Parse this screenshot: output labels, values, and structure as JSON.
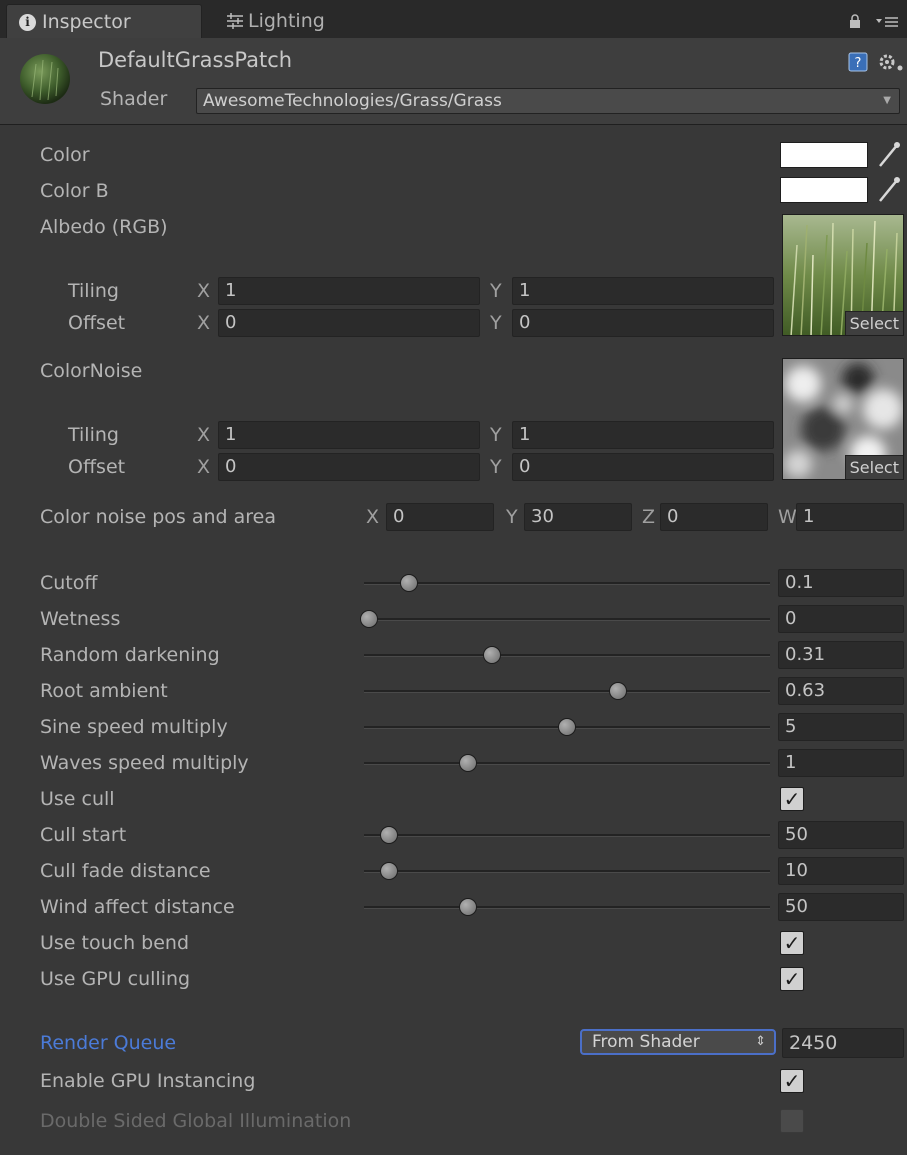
{
  "tabs": [
    {
      "label": "Inspector",
      "icon": "info-icon"
    },
    {
      "label": "Lighting",
      "icon": "lighting-sliders-icon"
    }
  ],
  "header": {
    "material_name": "DefaultGrassPatch",
    "shader_label": "Shader",
    "shader_value": "AwesomeTechnologies/Grass/Grass"
  },
  "properties": {
    "color_label": "Color",
    "color_b_label": "Color B",
    "color_value": "#FFFFFF",
    "color_b_value": "#FFFFFF",
    "albedo": {
      "label": "Albedo (RGB)",
      "tiling_label": "Tiling",
      "offset_label": "Offset",
      "tiling_x": "1",
      "tiling_y": "1",
      "offset_x": "0",
      "offset_y": "0",
      "select_label": "Select"
    },
    "color_noise": {
      "label": "ColorNoise",
      "tiling_label": "Tiling",
      "offset_label": "Offset",
      "tiling_x": "1",
      "tiling_y": "1",
      "offset_x": "0",
      "offset_y": "0",
      "select_label": "Select"
    },
    "axis": {
      "x": "X",
      "y": "Y",
      "z": "Z",
      "w": "W"
    },
    "noise_pos": {
      "label": "Color noise pos and area",
      "x": "0",
      "y": "30",
      "z": "0",
      "w": "1"
    },
    "sliders": [
      {
        "label": "Cutoff",
        "value": "0.1",
        "position": 0.1
      },
      {
        "label": "Wetness",
        "value": "0",
        "position": 0.0
      },
      {
        "label": "Random darkening",
        "value": "0.31",
        "position": 0.31
      },
      {
        "label": "Root ambient",
        "value": "0.63",
        "position": 0.63
      },
      {
        "label": "Sine speed multiply",
        "value": "5",
        "position": 0.5
      },
      {
        "label": "Waves speed multiply",
        "value": "1",
        "position": 0.25
      }
    ],
    "use_cull": {
      "label": "Use cull",
      "checked": true
    },
    "sliders2": [
      {
        "label": "Cull start",
        "value": "50",
        "position": 0.05
      },
      {
        "label": "Cull fade distance",
        "value": "10",
        "position": 0.05
      },
      {
        "label": "Wind affect distance",
        "value": "50",
        "position": 0.25
      }
    ],
    "use_touch_bend": {
      "label": "Use touch bend",
      "checked": true
    },
    "use_gpu_culling": {
      "label": "Use GPU culling",
      "checked": true
    }
  },
  "render_queue": {
    "label": "Render Queue",
    "dropdown": "From Shader",
    "value": "2450"
  },
  "gpu_instancing": {
    "label": "Enable GPU Instancing",
    "checked": true
  },
  "double_sided_gi": {
    "label": "Double Sided Global Illumination",
    "checked": false
  },
  "colors": {
    "background": "#383838",
    "accent_blue": "#4b7bd8",
    "text": "#b4b4b4"
  }
}
